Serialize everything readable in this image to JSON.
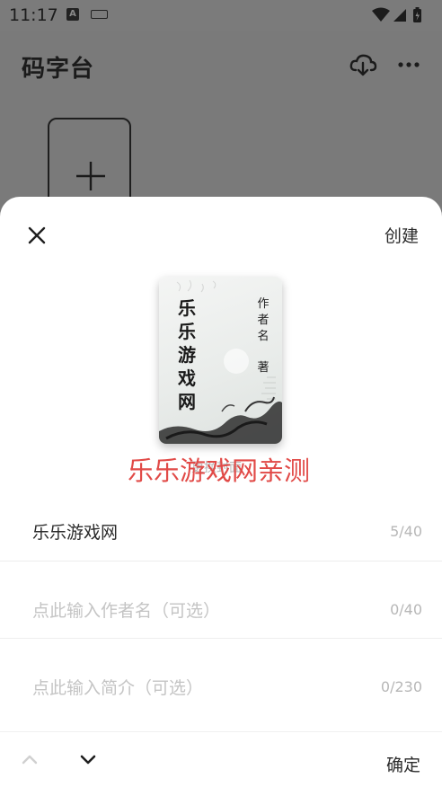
{
  "status_bar": {
    "time": "11:17",
    "notification_icon": "A"
  },
  "app": {
    "title": "码字台",
    "icons": [
      "cloud-sync-icon",
      "more-icon"
    ],
    "add_tile_icon": "plus-icon"
  },
  "sheet": {
    "close_icon": "close-icon",
    "create_label": "创建",
    "cover": {
      "title": "乐乐游戏网",
      "author": "作者名",
      "by_label": "著"
    },
    "replace_cover_label": "更换封面",
    "watermark": "乐乐游戏网亲测",
    "fields": [
      {
        "value": "乐乐游戏网",
        "placeholder": "",
        "count": "5/40"
      },
      {
        "value": "",
        "placeholder": "点此输入作者名（可选）",
        "count": "0/40"
      },
      {
        "value": "",
        "placeholder": "点此输入简介（可选）",
        "count": "0/230"
      }
    ],
    "bottom": {
      "confirm_label": "确定"
    }
  },
  "colors": {
    "overlay": "#7a7a7a",
    "sheet_bg": "#ffffff",
    "watermark": "#e14a47",
    "placeholder": "#c4c4c4"
  }
}
